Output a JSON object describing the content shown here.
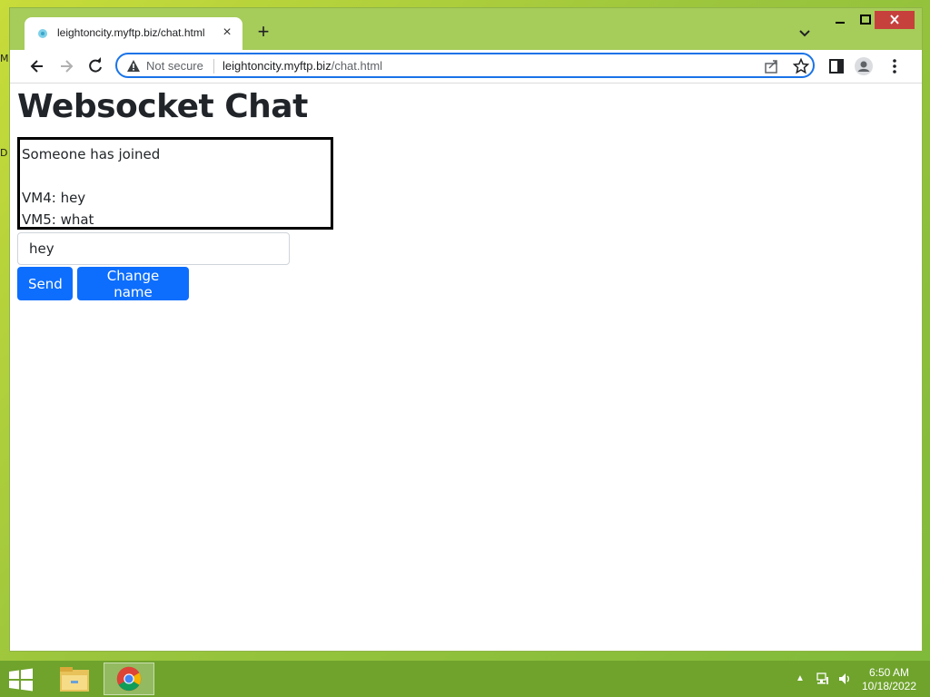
{
  "desktop": {
    "edge_letters": [
      "M",
      "D"
    ]
  },
  "browser": {
    "tab": {
      "title": "leightoncity.myftp.biz/chat.html",
      "close": "×"
    },
    "new_tab": "+",
    "address": {
      "security_label": "Not secure",
      "url_host": "leightoncity.myftp.biz",
      "url_path": "/chat.html"
    }
  },
  "page": {
    "title": "Websocket Chat",
    "messages": [
      "Someone has joined",
      "",
      "VM4: hey",
      "VM5: what"
    ],
    "input": {
      "value": "hey"
    },
    "buttons": {
      "send": "Send",
      "change_name": "Change name"
    },
    "accent_color": "#0d6efd"
  },
  "taskbar": {
    "time": "6:50 AM",
    "date": "10/18/2022"
  }
}
